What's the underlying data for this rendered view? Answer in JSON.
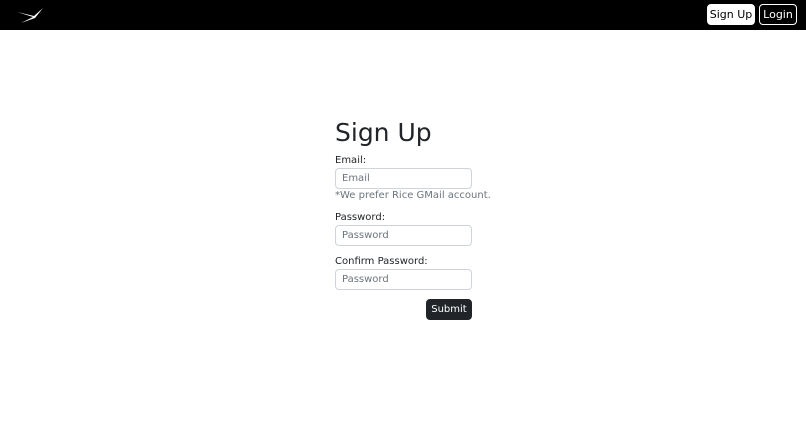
{
  "navbar": {
    "logo_icon": "spacex-swoosh-logo",
    "signup_label": "Sign Up",
    "login_label": "Login"
  },
  "form": {
    "title": "Sign Up",
    "email_label": "Email:",
    "email_placeholder": "Email",
    "email_hint": "*We prefer Rice GMail account.",
    "password_label": "Password:",
    "password_placeholder": "Password",
    "confirm_label": "Confirm Password:",
    "confirm_placeholder": "Password",
    "submit_label": "Submit"
  },
  "colors": {
    "navbar_bg": "#000000",
    "submit_bg": "#212529",
    "hint_text": "#6c757d"
  }
}
